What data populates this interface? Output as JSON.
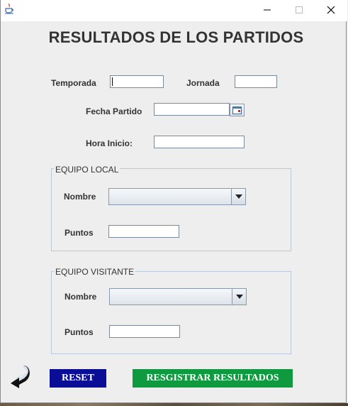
{
  "window": {
    "minimize_symbol": "—",
    "maximize_symbol": "☐",
    "close_symbol": "✕"
  },
  "header": {
    "title": "RESULTADOS DE LOS PARTIDOS"
  },
  "form": {
    "temporada_label": "Temporada",
    "temporada_value": "",
    "jornada_label": "Jornada",
    "jornada_value": "",
    "fecha_label": "Fecha Partido",
    "fecha_value": "",
    "hora_label": "Hora Inicio:",
    "hora_value": ""
  },
  "local": {
    "group_title": "EQUIPO LOCAL",
    "nombre_label": "Nombre",
    "nombre_value": "",
    "puntos_label": "Puntos",
    "puntos_value": ""
  },
  "visitante": {
    "group_title": "EQUIPO VISITANTE",
    "nombre_label": "Nombre",
    "nombre_value": "",
    "puntos_label": "Puntos",
    "puntos_value": ""
  },
  "actions": {
    "reset_label": "RESET",
    "register_label": "RESGISTRAR RESULTADOS"
  },
  "icons": {
    "app": "java-cup-icon",
    "calendar": "calendar-icon",
    "back": "back-arrow-icon"
  },
  "colors": {
    "reset_bg": "#0a0e96",
    "register_bg": "#109a40"
  }
}
